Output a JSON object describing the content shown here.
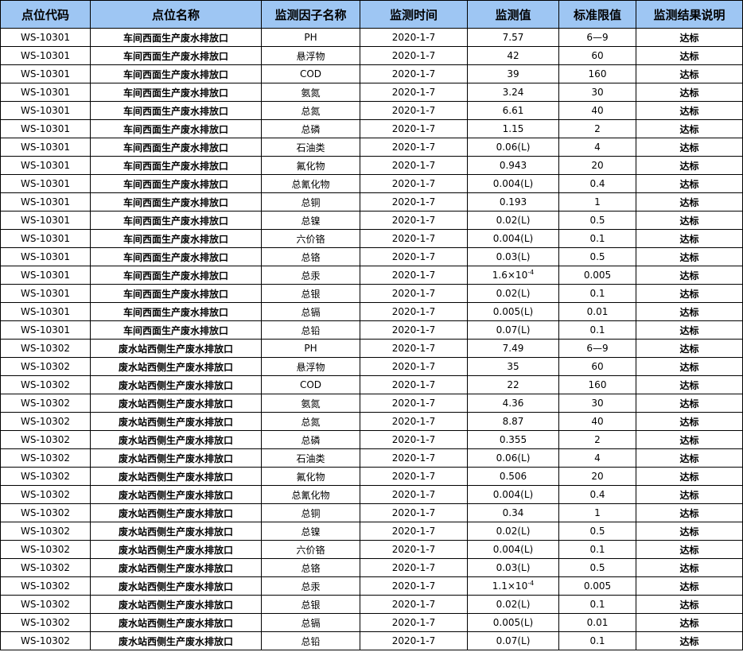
{
  "headers": [
    "点位代码",
    "点位名称",
    "监测因子名称",
    "监测时间",
    "监测值",
    "标准限值",
    "监测结果说明"
  ],
  "rows": [
    [
      "WS-10301",
      "车间西面生产废水排放口",
      "PH",
      "2020-1-7",
      "7.57",
      "6—9",
      "达标"
    ],
    [
      "WS-10301",
      "车间西面生产废水排放口",
      "悬浮物",
      "2020-1-7",
      "42",
      "60",
      "达标"
    ],
    [
      "WS-10301",
      "车间西面生产废水排放口",
      "COD",
      "2020-1-7",
      "39",
      "160",
      "达标"
    ],
    [
      "WS-10301",
      "车间西面生产废水排放口",
      "氨氮",
      "2020-1-7",
      "3.24",
      "30",
      "达标"
    ],
    [
      "WS-10301",
      "车间西面生产废水排放口",
      "总氮",
      "2020-1-7",
      "6.61",
      "40",
      "达标"
    ],
    [
      "WS-10301",
      "车间西面生产废水排放口",
      "总磷",
      "2020-1-7",
      "1.15",
      "2",
      "达标"
    ],
    [
      "WS-10301",
      "车间西面生产废水排放口",
      "石油类",
      "2020-1-7",
      "0.06(L)",
      "4",
      "达标"
    ],
    [
      "WS-10301",
      "车间西面生产废水排放口",
      "氟化物",
      "2020-1-7",
      "0.943",
      "20",
      "达标"
    ],
    [
      "WS-10301",
      "车间西面生产废水排放口",
      "总氰化物",
      "2020-1-7",
      "0.004(L)",
      "0.4",
      "达标"
    ],
    [
      "WS-10301",
      "车间西面生产废水排放口",
      "总铜",
      "2020-1-7",
      "0.193",
      "1",
      "达标"
    ],
    [
      "WS-10301",
      "车间西面生产废水排放口",
      "总镍",
      "2020-1-7",
      "0.02(L)",
      "0.5",
      "达标"
    ],
    [
      "WS-10301",
      "车间西面生产废水排放口",
      "六价铬",
      "2020-1-7",
      "0.004(L)",
      "0.1",
      "达标"
    ],
    [
      "WS-10301",
      "车间西面生产废水排放口",
      "总铬",
      "2020-1-7",
      "0.03(L)",
      "0.5",
      "达标"
    ],
    [
      "WS-10301",
      "车间西面生产废水排放口",
      "总汞",
      "2020-1-7",
      "1.6×10-4",
      "0.005",
      "达标"
    ],
    [
      "WS-10301",
      "车间西面生产废水排放口",
      "总银",
      "2020-1-7",
      "0.02(L)",
      "0.1",
      "达标"
    ],
    [
      "WS-10301",
      "车间西面生产废水排放口",
      "总镉",
      "2020-1-7",
      "0.005(L)",
      "0.01",
      "达标"
    ],
    [
      "WS-10301",
      "车间西面生产废水排放口",
      "总铅",
      "2020-1-7",
      "0.07(L)",
      "0.1",
      "达标"
    ],
    [
      "WS-10302",
      "废水站西侧生产废水排放口",
      "PH",
      "2020-1-7",
      "7.49",
      "6—9",
      "达标"
    ],
    [
      "WS-10302",
      "废水站西侧生产废水排放口",
      "悬浮物",
      "2020-1-7",
      "35",
      "60",
      "达标"
    ],
    [
      "WS-10302",
      "废水站西侧生产废水排放口",
      "COD",
      "2020-1-7",
      "22",
      "160",
      "达标"
    ],
    [
      "WS-10302",
      "废水站西侧生产废水排放口",
      "氨氮",
      "2020-1-7",
      "4.36",
      "30",
      "达标"
    ],
    [
      "WS-10302",
      "废水站西侧生产废水排放口",
      "总氮",
      "2020-1-7",
      "8.87",
      "40",
      "达标"
    ],
    [
      "WS-10302",
      "废水站西侧生产废水排放口",
      "总磷",
      "2020-1-7",
      "0.355",
      "2",
      "达标"
    ],
    [
      "WS-10302",
      "废水站西侧生产废水排放口",
      "石油类",
      "2020-1-7",
      "0.06(L)",
      "4",
      "达标"
    ],
    [
      "WS-10302",
      "废水站西侧生产废水排放口",
      "氟化物",
      "2020-1-7",
      "0.506",
      "20",
      "达标"
    ],
    [
      "WS-10302",
      "废水站西侧生产废水排放口",
      "总氰化物",
      "2020-1-7",
      "0.004(L)",
      "0.4",
      "达标"
    ],
    [
      "WS-10302",
      "废水站西侧生产废水排放口",
      "总铜",
      "2020-1-7",
      "0.34",
      "1",
      "达标"
    ],
    [
      "WS-10302",
      "废水站西侧生产废水排放口",
      "总镍",
      "2020-1-7",
      "0.02(L)",
      "0.5",
      "达标"
    ],
    [
      "WS-10302",
      "废水站西侧生产废水排放口",
      "六价铬",
      "2020-1-7",
      "0.004(L)",
      "0.1",
      "达标"
    ],
    [
      "WS-10302",
      "废水站西侧生产废水排放口",
      "总铬",
      "2020-1-7",
      "0.03(L)",
      "0.5",
      "达标"
    ],
    [
      "WS-10302",
      "废水站西侧生产废水排放口",
      "总汞",
      "2020-1-7",
      "1.1×10-4",
      "0.005",
      "达标"
    ],
    [
      "WS-10302",
      "废水站西侧生产废水排放口",
      "总银",
      "2020-1-7",
      "0.02(L)",
      "0.1",
      "达标"
    ],
    [
      "WS-10302",
      "废水站西侧生产废水排放口",
      "总镉",
      "2020-1-7",
      "0.005(L)",
      "0.01",
      "达标"
    ],
    [
      "WS-10302",
      "废水站西侧生产废水排放口",
      "总铅",
      "2020-1-7",
      "0.07(L)",
      "0.1",
      "达标"
    ]
  ],
  "colors": {
    "header_bg": "#9ec6f3",
    "border": "#000000"
  }
}
